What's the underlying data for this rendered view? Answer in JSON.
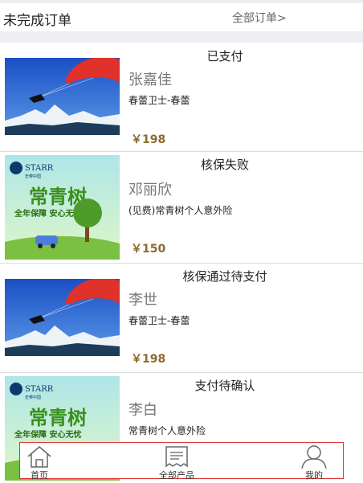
{
  "header": {
    "title": "未完成订单",
    "all_orders": "全部订单>"
  },
  "orders": [
    {
      "status": "已支付",
      "name": "张嘉佳",
      "product": "春蕾卫士-春蕾",
      "price": "￥198",
      "image": "paraglider-mountain"
    },
    {
      "status": "核保失败",
      "name": "邓丽欣",
      "product": "(见费)常青树个人意外险",
      "price": "￥150",
      "image": "starr-changqingshu-banner"
    },
    {
      "status": "核保通过待支付",
      "name": "李世",
      "product": "春蕾卫士-春蕾",
      "price": "￥198",
      "image": "paraglider-mountain"
    },
    {
      "status": "支付待确认",
      "name": "李白",
      "product": "常青树个人意外险",
      "price": "",
      "image": "starr-changqingshu-banner"
    }
  ],
  "banner": {
    "brand": "STARR",
    "brand_sub": "史带中国",
    "slogan": "常青树",
    "tagline": "全年保障 安心无忧"
  },
  "tabbar": {
    "home": "首页",
    "products": "全部产品",
    "mine": "我的"
  },
  "colors": {
    "price": "#8b6a2f",
    "tab_border": "#dd3333",
    "background_gap": "#eeeef2"
  }
}
